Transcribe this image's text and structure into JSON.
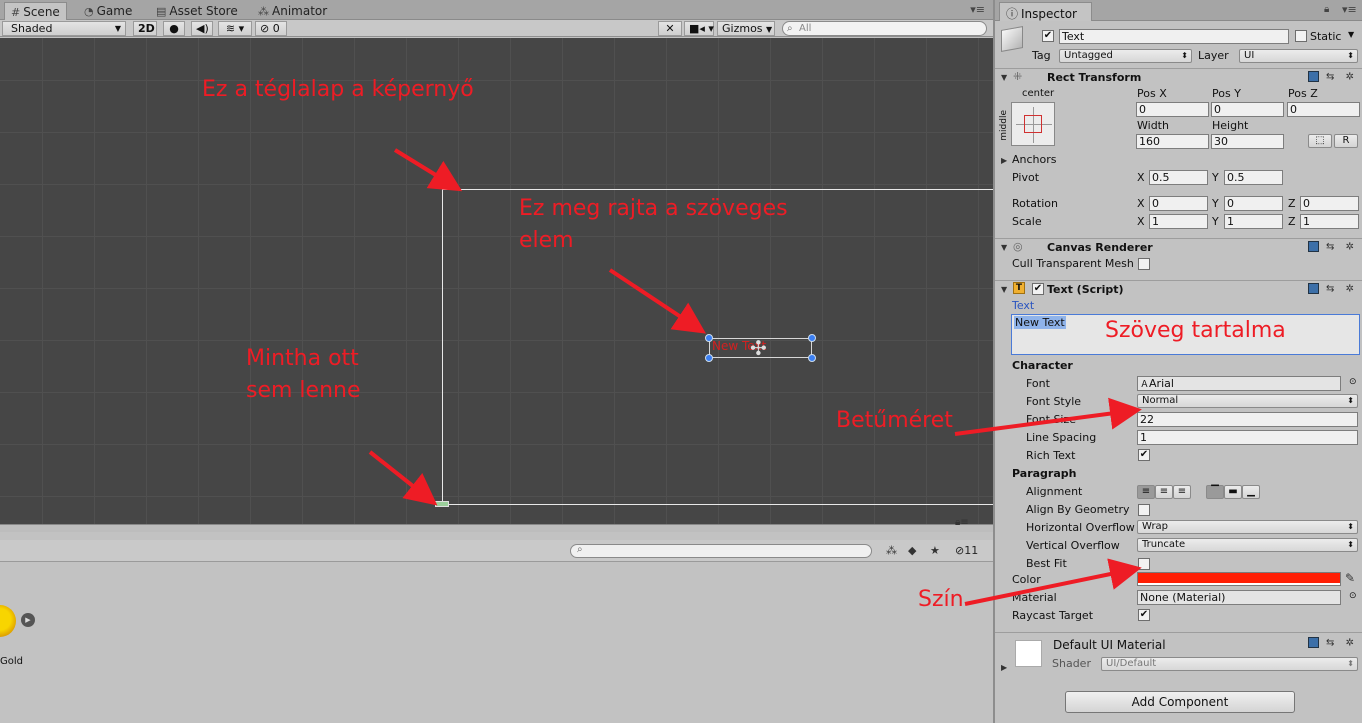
{
  "scene": {
    "tabs": [
      {
        "label": "Scene",
        "icon": "hash-grid-icon"
      },
      {
        "label": "Game",
        "icon": "pacman-icon"
      },
      {
        "label": "Asset Store",
        "icon": "store-icon"
      },
      {
        "label": "Animator",
        "icon": "animator-icon"
      }
    ],
    "toolbar": {
      "shading_mode": "Shaded",
      "mode_2d": "2D",
      "hidden_count": "0",
      "gizmos": "Gizmos",
      "search_placeholder": "All"
    },
    "viewport": {
      "text_element_sample": "New Text"
    },
    "annotations": {
      "screen_rect": "Ez a téglalap a képernyő",
      "text_element_line1": "Ez meg rajta a szöveges",
      "text_element_line2": "elem",
      "not_there_line1": "Mintha ott",
      "not_there_line2": "sem lenne",
      "font_size": "Betűméret",
      "color": "Szín",
      "text_content": "Szöveg tartalma"
    }
  },
  "project": {
    "hidden_count": "11",
    "asset_label": "Gold"
  },
  "inspector": {
    "tab_label": "Inspector",
    "gameobject": {
      "name": "Text",
      "active": true,
      "static_label": "Static",
      "tag_label": "Tag",
      "tag_value": "Untagged",
      "layer_label": "Layer",
      "layer_value": "UI"
    },
    "rect_transform": {
      "title": "Rect Transform",
      "anchor_h": "center",
      "anchor_v": "middle",
      "pos_x_label": "Pos X",
      "pos_y_label": "Pos Y",
      "pos_z_label": "Pos Z",
      "pos_x": "0",
      "pos_y": "0",
      "pos_z": "0",
      "width_label": "Width",
      "height_label": "Height",
      "width": "160",
      "height": "30",
      "r_button": "R",
      "anchors_label": "Anchors",
      "pivot_label": "Pivot",
      "pivot_x": "0.5",
      "pivot_y": "0.5",
      "rotation_label": "Rotation",
      "rot_x": "0",
      "rot_y": "0",
      "rot_z": "0",
      "scale_label": "Scale",
      "scale_x": "1",
      "scale_y": "1",
      "scale_z": "1",
      "x": "X",
      "y": "Y",
      "z": "Z"
    },
    "canvas_renderer": {
      "title": "Canvas Renderer",
      "cull_label": "Cull Transparent Mesh"
    },
    "text_script": {
      "title": "Text (Script)",
      "text_label": "Text",
      "text_value": "New Text",
      "character_section": "Character",
      "font_label": "Font",
      "font_value": "Arial",
      "font_style_label": "Font Style",
      "font_style_value": "Normal",
      "font_size_label": "Font Size",
      "font_size_value": "22",
      "line_spacing_label": "Line Spacing",
      "line_spacing_value": "1",
      "rich_text_label": "Rich Text",
      "paragraph_section": "Paragraph",
      "alignment_label": "Alignment",
      "align_geom_label": "Align By Geometry",
      "h_overflow_label": "Horizontal Overflow",
      "h_overflow_value": "Wrap",
      "v_overflow_label": "Vertical Overflow",
      "v_overflow_value": "Truncate",
      "best_fit_label": "Best Fit",
      "color_label": "Color",
      "color_value": "#ff1e04",
      "material_label": "Material",
      "material_value": "None (Material)",
      "raycast_label": "Raycast Target"
    },
    "material": {
      "title": "Default UI Material",
      "shader_label": "Shader",
      "shader_value": "UI/Default"
    },
    "add_component": "Add Component"
  }
}
